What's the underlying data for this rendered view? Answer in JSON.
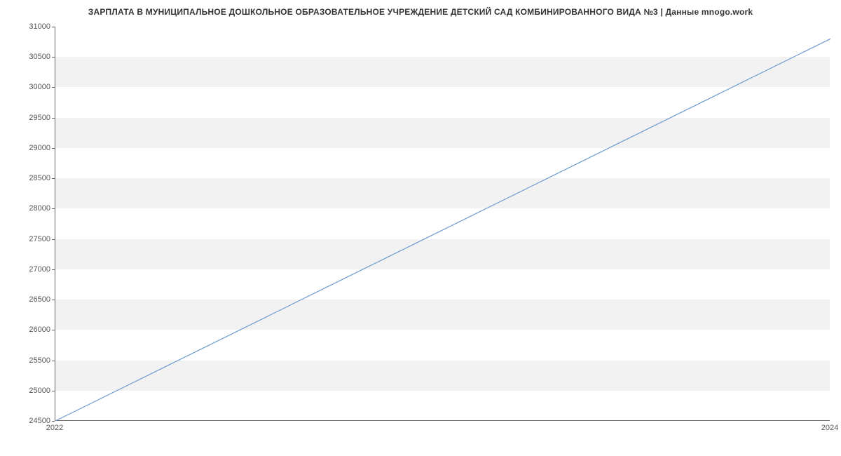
{
  "chart_data": {
    "type": "line",
    "title": "ЗАРПЛАТА В МУНИЦИПАЛЬНОЕ ДОШКОЛЬНОЕ ОБРАЗОВАТЕЛЬНОЕ УЧРЕЖДЕНИЕ ДЕТСКИЙ САД КОМБИНИРОВАННОГО ВИДА №3 | Данные mnogo.work",
    "x": [
      2022,
      2024
    ],
    "values": [
      24500,
      30800
    ],
    "xlabel": "",
    "ylabel": "",
    "xlim": [
      2022,
      2024
    ],
    "ylim": [
      24500,
      31000
    ],
    "x_ticks": [
      2022,
      2024
    ],
    "y_ticks": [
      24500,
      25000,
      25500,
      26000,
      26500,
      27000,
      27500,
      28000,
      28500,
      29000,
      29500,
      30000,
      30500,
      31000
    ],
    "line_color": "#6b9bd1",
    "band_color": "#f2f2f2"
  }
}
